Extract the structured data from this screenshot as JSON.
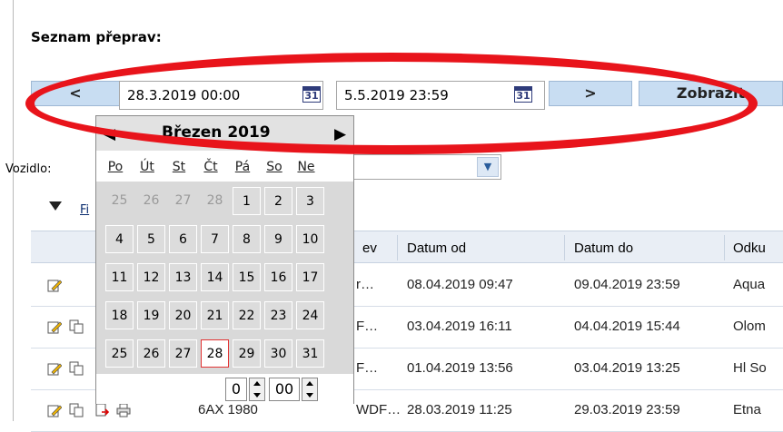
{
  "page": {
    "title": "Seznam přeprav:"
  },
  "toolbar": {
    "prev_label": "<",
    "from_date": "28.3.2019 00:00",
    "to_date": "5.5.2019 23:59",
    "next_label": ">",
    "show_label": "Zobrazit",
    "calendar_icon_text": "31"
  },
  "filter": {
    "vehicle_label": "Vozidlo:",
    "filter_link": "Fi"
  },
  "calendar": {
    "month_label": "Březen 2019",
    "weekdays": [
      "Po",
      "Út",
      "St",
      "Čt",
      "Pá",
      "So",
      "Ne"
    ],
    "weeks": [
      [
        "25",
        "26",
        "27",
        "28",
        "1",
        "2",
        "3"
      ],
      [
        "4",
        "5",
        "6",
        "7",
        "8",
        "9",
        "10"
      ],
      [
        "11",
        "12",
        "13",
        "14",
        "15",
        "16",
        "17"
      ],
      [
        "18",
        "19",
        "20",
        "21",
        "22",
        "23",
        "24"
      ],
      [
        "25",
        "26",
        "27",
        "28",
        "29",
        "30",
        "31"
      ]
    ],
    "previous_month_days_in_first_row": 4,
    "selected_day": "28",
    "hours": "0",
    "minutes": "00"
  },
  "grid": {
    "columns": [
      "ev",
      "Datum od",
      "Datum do",
      "Odku"
    ],
    "rows": [
      {
        "col_a": "",
        "col_b": "r…",
        "date_from": "08.04.2019 09:47",
        "date_to": "09.04.2019 23:59",
        "dest": "Aqua"
      },
      {
        "col_a": "",
        "col_b": "F…",
        "date_from": "03.04.2019 16:11",
        "date_to": "04.04.2019 15:44",
        "dest": "Olom"
      },
      {
        "col_a": "",
        "col_b": "F…",
        "date_from": "01.04.2019 13:56",
        "date_to": "03.04.2019 13:25",
        "dest": "Hl So"
      },
      {
        "col_a": "6AX 1980",
        "col_b": "WDF…",
        "date_from": "28.03.2019 11:25",
        "date_to": "29.03.2019 23:59",
        "dest": "Etna"
      }
    ]
  },
  "colors": {
    "button_bg": "#c8ddf2",
    "highlight_oval": "#e8141b",
    "selected_day_border": "#e23232"
  }
}
